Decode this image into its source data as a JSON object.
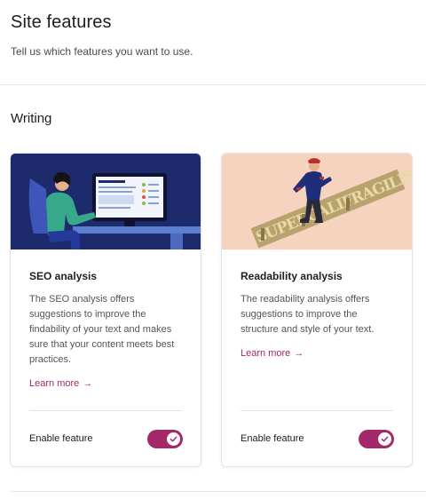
{
  "page": {
    "title": "Site features",
    "subtitle": "Tell us which features you want to use."
  },
  "section": {
    "title": "Writing"
  },
  "cards": [
    {
      "title": "SEO analysis",
      "description": "The SEO analysis offers suggestions to improve the findability of your text and makes sure that your content meets best practices.",
      "learn_more": "Learn more",
      "arrow": "→",
      "toggle_label": "Enable feature",
      "enabled": true,
      "image_bg": "#1d2a6b"
    },
    {
      "title": "Readability analysis",
      "description": "The readability analysis offers suggestions to improve the structure and style of your text.",
      "learn_more": "Learn more",
      "arrow": "→",
      "toggle_label": "Enable feature",
      "enabled": true,
      "image_bg": "#f6d3bf",
      "image_text": "SUPERCALIFRAGILISTICEXPIALIDOCIOUS"
    }
  ],
  "colors": {
    "accent": "#a4286a",
    "text": "#1e1e1e",
    "muted": "#555555"
  }
}
